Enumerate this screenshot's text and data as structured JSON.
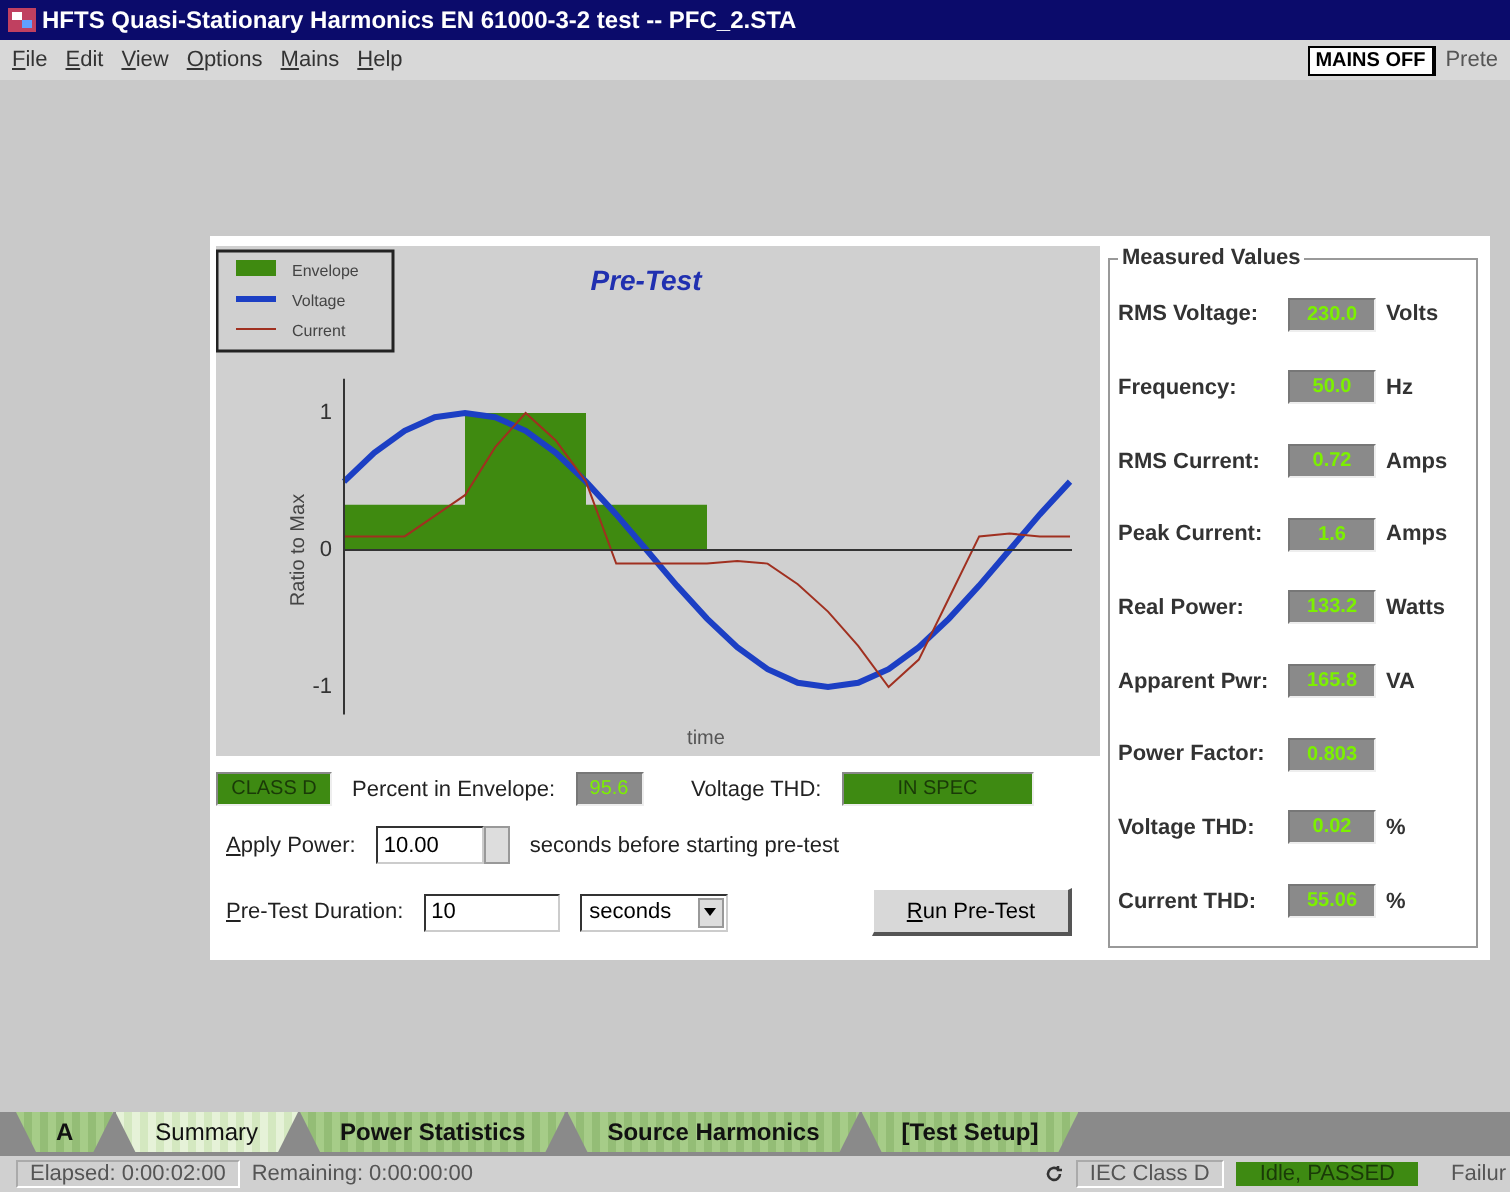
{
  "window": {
    "title": "HFTS Quasi-Stationary Harmonics EN 61000-3-2 test -- PFC_2.STA"
  },
  "menu": [
    "File",
    "Edit",
    "View",
    "Options",
    "Mains",
    "Help"
  ],
  "mains_button": "MAINS OFF",
  "menu_right_cut": "Prete",
  "chart": {
    "title": "Pre-Test",
    "xlabel": "time",
    "ylabel": "Ratio to Max",
    "yticks": [
      "1",
      "0",
      "-1"
    ],
    "legend": [
      {
        "label": "Envelope",
        "kind": "area"
      },
      {
        "label": "Voltage",
        "kind": "thick"
      },
      {
        "label": "Current",
        "kind": "thin"
      }
    ]
  },
  "indicators": {
    "class": "CLASS D",
    "percent_label": "Percent in Envelope:",
    "percent_value": "95.6",
    "thd_label": "Voltage THD:",
    "thd_value": "IN SPEC"
  },
  "apply_power": {
    "label": "Apply Power:",
    "value": "10.00",
    "suffix": "seconds before starting pre-test"
  },
  "duration": {
    "label": "Pre-Test Duration:",
    "value": "10",
    "unit": "seconds"
  },
  "run_button": "Run Pre-Test",
  "measured": {
    "title": "Measured Values",
    "rows": [
      {
        "label": "RMS Voltage:",
        "value": "230.0",
        "unit": "Volts"
      },
      {
        "label": "Frequency:",
        "value": "50.0",
        "unit": "Hz"
      },
      {
        "label": "RMS Current:",
        "value": "0.72",
        "unit": "Amps"
      },
      {
        "label": "Peak Current:",
        "value": "1.6",
        "unit": "Amps"
      },
      {
        "label": "Real Power:",
        "value": "133.2",
        "unit": "Watts"
      },
      {
        "label": "Apparent Pwr:",
        "value": "165.8",
        "unit": "VA"
      },
      {
        "label": "Power Factor:",
        "value": "0.803"
      },
      {
        "label": "Voltage THD:",
        "value": "0.02",
        "unit": "%"
      },
      {
        "label": "Current THD:",
        "value": "55.06",
        "unit": "%"
      }
    ]
  },
  "tabs": [
    {
      "label": "A",
      "selected": false
    },
    {
      "label": "Summary",
      "selected": true
    },
    {
      "label": "Power Statistics",
      "selected": false
    },
    {
      "label": "Source Harmonics",
      "selected": false
    },
    {
      "label": "[Test Setup]",
      "selected": false
    }
  ],
  "status_bar": {
    "elapsed": "Elapsed: 0:00:02:00",
    "remaining": "Remaining: 0:00:00:00",
    "class": "IEC Class D",
    "state": "Idle, PASSED",
    "cut": "Failur"
  }
}
